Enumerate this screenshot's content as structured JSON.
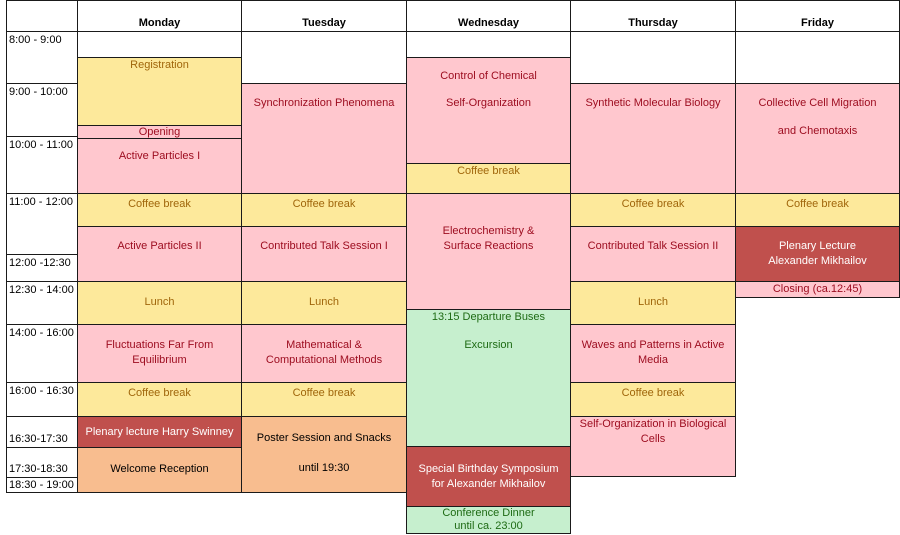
{
  "days": [
    "Monday",
    "Tuesday",
    "Wednesday",
    "Thursday",
    "Friday"
  ],
  "times": [
    "8:00 - 9:00",
    "9:00 - 10:00",
    "10:00 - 11:00",
    "11:00 - 12:00",
    "12:00 -12:30",
    "12:30 - 14:00",
    "14:00 - 16:00",
    "16:00 - 16:30",
    "16:30-17:30",
    "17:30-18:30",
    "18:30 - 19:00"
  ],
  "colors": {
    "break": "#fde99b",
    "session": "#ffc7ce",
    "plenary": "#c0504d",
    "social": "#f8bd8f",
    "excursion": "#c6efce"
  },
  "monday": {
    "registration": "Registration",
    "opening": "Opening",
    "active1": "Active Particles I",
    "coffee1": "Coffee break",
    "active2": "Active Particles II",
    "lunch": "Lunch",
    "fluct1": "Fluctuations Far From",
    "fluct2": "Equilibrium",
    "coffee2": "Coffee break",
    "plenary": "Plenary lecture Harry Swinney",
    "welcome": "Welcome Reception"
  },
  "tuesday": {
    "sync": "Synchronization Phenomena",
    "coffee1": "Coffee break",
    "contrib": "Contributed Talk Session I",
    "lunch": "Lunch",
    "math1": "Mathematical &",
    "math2": "Computational Methods",
    "coffee2": "Coffee break",
    "poster1": "Poster Session and Snacks",
    "poster2": "until  19:30"
  },
  "wednesday": {
    "control1": "Control of Chemical",
    "control2": "Self-Organization",
    "coffee": "Coffee break",
    "electro1": "Electrochemistry &",
    "electro2": "Surface Reactions",
    "bus": "13:15  Departure Buses",
    "excursion": "Excursion",
    "bday1": "Special Birthday Symposium",
    "bday2": "for Alexander Mikhailov",
    "dinner1": "Conference Dinner",
    "dinner2": "until ca. 23:00"
  },
  "thursday": {
    "synth": "Synthetic Molecular Biology",
    "coffee1": "Coffee break",
    "contrib": "Contributed Talk Session II",
    "lunch": "Lunch",
    "waves1": "Waves and Patterns in Active",
    "waves2": "Media",
    "coffee2": "Coffee break",
    "selforg1": "Self-Organization in Biological",
    "selforg2": "Cells"
  },
  "friday": {
    "cell1": "Collective Cell Migration",
    "cell2": "and Chemotaxis",
    "coffee": "Coffee break",
    "plenary1": "Plenary Lecture",
    "plenary2": "Alexander Mikhailov",
    "closing": "Closing (ca.12:45)"
  }
}
